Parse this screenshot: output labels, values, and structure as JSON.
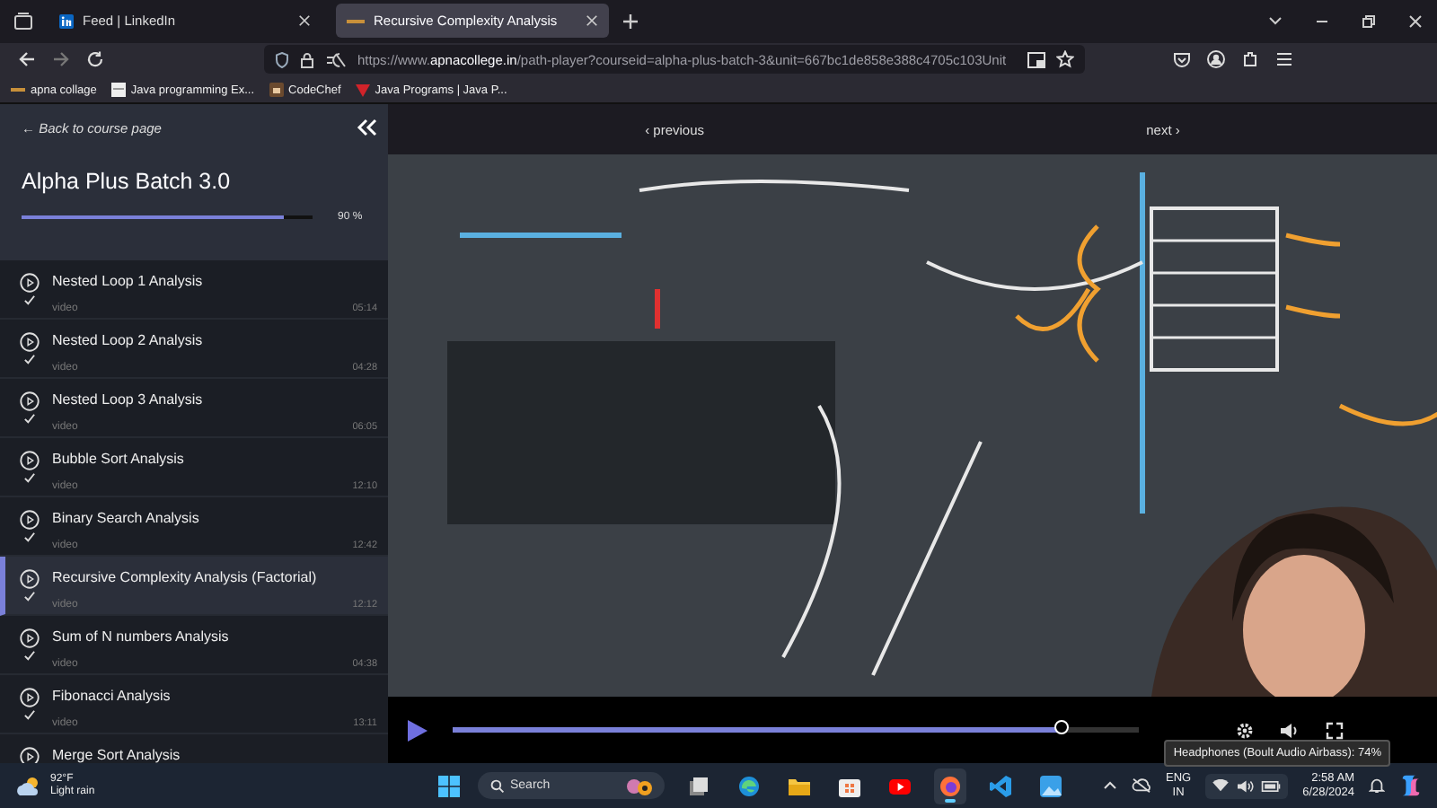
{
  "browser": {
    "tabs": [
      {
        "title": "Feed | LinkedIn",
        "kind": "linkedin",
        "selected": false
      },
      {
        "title": "Recursive Complexity Analysis",
        "kind": "site",
        "selected": true
      }
    ],
    "url": {
      "prefix": "https://www.",
      "host": "apnacollege.in",
      "path": "/path-player?courseid=alpha-plus-batch-3&unit=667bc1de858e388c4705c103Unit"
    },
    "bookmarks": [
      {
        "label": "apna collage",
        "kind": "site"
      },
      {
        "label": "Java programming Ex...",
        "kind": "page"
      },
      {
        "label": "CodeChef",
        "kind": "cc"
      },
      {
        "label": "Java Programs | Java P...",
        "kind": "triangle"
      }
    ]
  },
  "sidebar": {
    "back_link": "← Back to course page",
    "course_title": "Alpha Plus Batch 3.0",
    "progress": {
      "level": 0.9,
      "reading": "90 %"
    },
    "lessons": [
      {
        "title": "Nested Loop 1 Analysis",
        "type": "video",
        "duration": "05:14",
        "completed": true,
        "selected": false
      },
      {
        "title": "Nested Loop 2 Analysis",
        "type": "video",
        "duration": "04:28",
        "completed": true,
        "selected": false
      },
      {
        "title": "Nested Loop 3 Analysis",
        "type": "video",
        "duration": "06:05",
        "completed": true,
        "selected": false
      },
      {
        "title": "Bubble Sort Analysis",
        "type": "video",
        "duration": "12:10",
        "completed": true,
        "selected": false
      },
      {
        "title": "Binary Search Analysis",
        "type": "video",
        "duration": "12:42",
        "completed": true,
        "selected": false
      },
      {
        "title": "Recursive Complexity Analysis (Factorial)",
        "type": "video",
        "duration": "12:12",
        "completed": true,
        "selected": true
      },
      {
        "title": "Sum of N numbers Analysis",
        "type": "video",
        "duration": "04:38",
        "completed": true,
        "selected": false
      },
      {
        "title": "Fibonacci Analysis",
        "type": "video",
        "duration": "13:11",
        "completed": true,
        "selected": false
      },
      {
        "title": "Merge Sort Analysis",
        "selected": false
      }
    ]
  },
  "player": {
    "previous": "‹ previous",
    "next": "next ›",
    "progress": {
      "level": 0.89
    },
    "tooltip": "Headphones (Boult Audio Airbass): 74%"
  },
  "taskbar": {
    "weather": {
      "temperature": "92°F",
      "condition": "Light rain"
    },
    "search": {
      "placeholder": "Search"
    },
    "apps": [
      {
        "kind": "taskview",
        "selected": false
      },
      {
        "kind": "edge",
        "selected": false
      },
      {
        "kind": "folder",
        "selected": false
      },
      {
        "kind": "store",
        "selected": false
      },
      {
        "kind": "youtube",
        "selected": false
      },
      {
        "kind": "firefox",
        "selected": true
      },
      {
        "kind": "vscode",
        "selected": false
      },
      {
        "kind": "photos",
        "selected": false
      }
    ],
    "language": "ENG",
    "region": "IN",
    "time": "2:58 AM",
    "date": "6/28/2024"
  }
}
